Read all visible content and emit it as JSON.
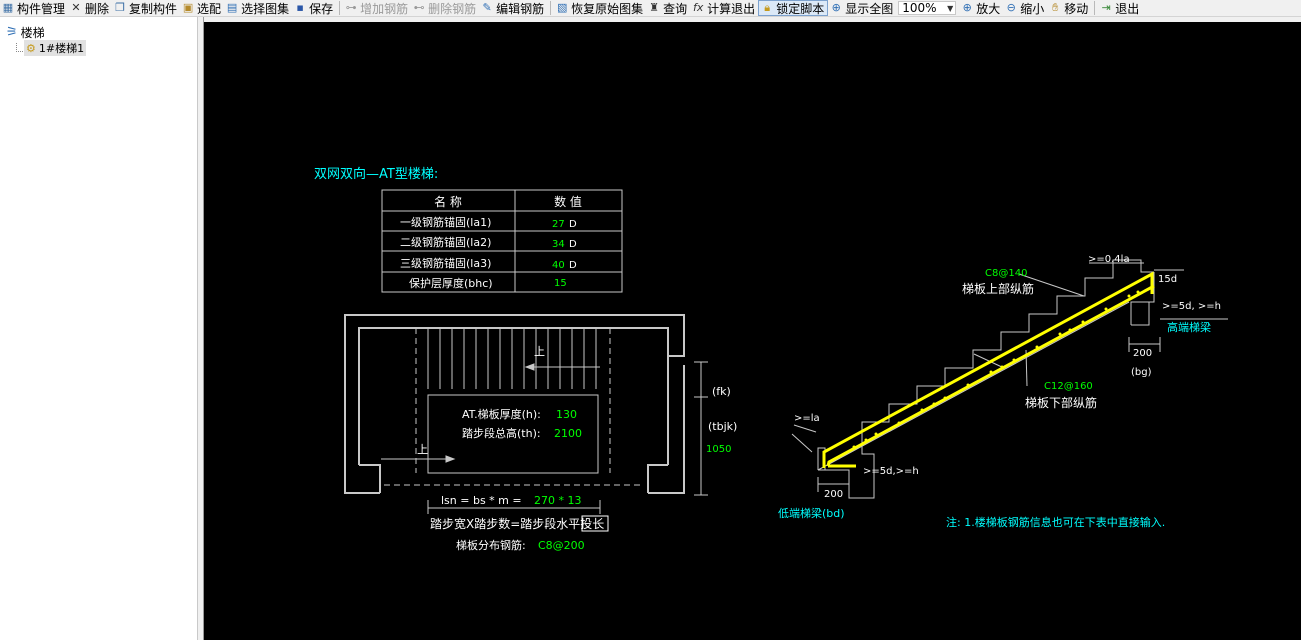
{
  "toolbar": {
    "component_manage": "构件管理",
    "delete": "删除",
    "copy_component": "复制构件",
    "select_fit": "选配",
    "select_atlas": "选择图集",
    "save": "保存",
    "add_rebar": "增加钢筋",
    "delete_rebar": "删除钢筋",
    "edit_rebar": "编辑钢筋",
    "restore_atlas": "恢复原始图集",
    "query": "查询",
    "calc_exit": "计算退出",
    "lock_script": "锁定脚本",
    "show_all": "显示全图",
    "zoom_value": "100%",
    "zoom_in": "放大",
    "zoom_out": "缩小",
    "move": "移动",
    "exit": "退出"
  },
  "tree": {
    "root": "楼梯",
    "child": "1#楼梯1"
  },
  "drawing": {
    "title": "双网双向—AT型楼梯:",
    "table": {
      "headers": [
        "名  称",
        "数  值"
      ],
      "rows": [
        {
          "name": "一级钢筋锚固(la1)",
          "value": "27",
          "unit": "D"
        },
        {
          "name": "二级钢筋锚固(la2)",
          "value": "34",
          "unit": "D"
        },
        {
          "name": "三级钢筋锚固(la3)",
          "value": "40",
          "unit": "D"
        },
        {
          "name": "保护层厚度(bhc)",
          "value": "15",
          "unit": ""
        }
      ]
    },
    "plan": {
      "up1": "上",
      "up2": "上",
      "thickness_label": "AT.梯板厚度(h):",
      "thickness_value": "130",
      "height_label": "踏步段总高(th):",
      "height_value": "2100",
      "fk": "(fk)",
      "tbjk": "(tbjk)",
      "tbjk_value": "1050",
      "formula_prefix": "lsn = bs * m = ",
      "formula_value": "270 * 13",
      "formula_desc": "踏步宽X踏步数=踏步段水平投长",
      "dist_label": "梯板分布钢筋:",
      "dist_value": "C8@200"
    },
    "section": {
      "top_rebar_spec": "C8@140",
      "top_rebar_label": "梯板上部纵筋",
      "bottom_rebar_spec": "C12@160",
      "bottom_rebar_label": "梯板下部纵筋",
      "la_top": ">=0.4la",
      "d15": "15d",
      "anchor_high": ">=5d, >=h",
      "high_beam": "高端梯梁",
      "bg_dim": "200",
      "bg": "(bg)",
      "la_low": ">=la",
      "anchor_low": ">=5d,>=h",
      "bd_dim": "200",
      "low_beam": "低端梯梁(bd)"
    },
    "note": "注: 1.楼梯板钢筋信息也可在下表中直接输入."
  },
  "colors": {
    "canvas_bg": "#000000",
    "cad_cyan": "#00ffff",
    "cad_green": "#00ff00",
    "cad_white": "#ffffff",
    "cad_yellow": "#ffff00",
    "cad_grey": "#c8c8c8"
  },
  "icons": [
    "component-manage-icon",
    "delete-icon",
    "copy-icon",
    "select-fit-icon",
    "atlas-icon",
    "save-icon",
    "add-rebar-icon",
    "delete-rebar-icon",
    "edit-rebar-icon",
    "restore-icon",
    "query-icon",
    "calc-icon",
    "lock-icon",
    "show-all-icon",
    "zoom-in-icon",
    "zoom-out-icon",
    "move-icon",
    "exit-icon",
    "stair-tree-icon",
    "gear-icon"
  ]
}
